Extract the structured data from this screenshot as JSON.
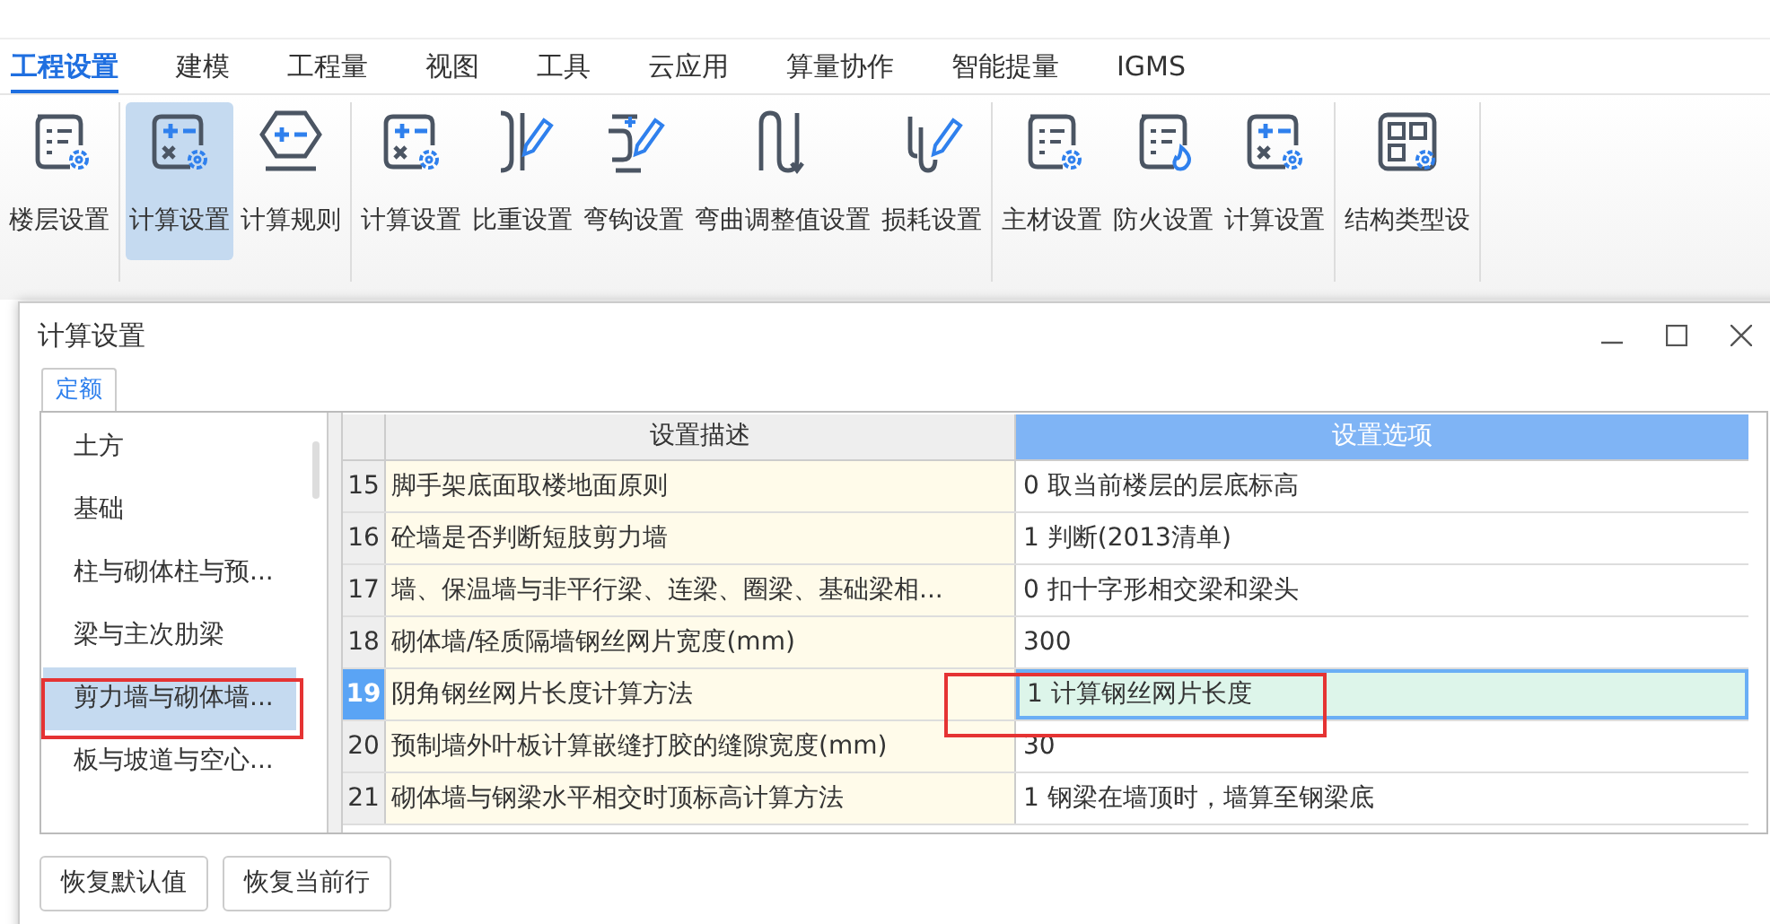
{
  "menu_tabs": [
    {
      "label": "工程设置",
      "selected": true
    },
    {
      "label": "建模",
      "selected": false
    },
    {
      "label": "工程量",
      "selected": false
    },
    {
      "label": "视图",
      "selected": false
    },
    {
      "label": "工具",
      "selected": false
    },
    {
      "label": "云应用",
      "selected": false
    },
    {
      "label": "算量协作",
      "selected": false
    },
    {
      "label": "智能提量",
      "selected": false
    },
    {
      "label": "IGMS",
      "selected": false
    }
  ],
  "ribbon_groups": [
    {
      "buttons": [
        {
          "label": "楼层设置",
          "kind": "doc",
          "selected": false
        }
      ]
    },
    {
      "buttons": [
        {
          "label": "计算设置",
          "kind": "calc",
          "selected": true
        },
        {
          "label": "计算规则",
          "kind": "rule",
          "selected": false
        }
      ]
    },
    {
      "buttons": [
        {
          "label": "计算设置",
          "kind": "calc",
          "selected": false
        },
        {
          "label": "比重设置",
          "kind": "hookpen",
          "selected": false
        },
        {
          "label": "弯钩设置",
          "kind": "bendpen",
          "selected": false
        },
        {
          "label": "弯曲调整值设置",
          "kind": "wave",
          "selected": false
        },
        {
          "label": "损耗设置",
          "kind": "wirepen",
          "selected": false
        }
      ]
    },
    {
      "buttons": [
        {
          "label": "主材设置",
          "kind": "doc",
          "selected": false
        },
        {
          "label": "防火设置",
          "kind": "fire",
          "selected": false
        },
        {
          "label": "计算设置",
          "kind": "calc",
          "selected": false
        }
      ]
    },
    {
      "buttons": [
        {
          "label": "结构类型设",
          "kind": "grid",
          "selected": false
        }
      ]
    }
  ],
  "dialog": {
    "title": "计算设置",
    "tabs": [
      {
        "label": "定额",
        "selected": true
      }
    ],
    "categories": [
      {
        "label": "土方",
        "selected": false
      },
      {
        "label": "基础",
        "selected": false
      },
      {
        "label": "柱与砌体柱与预...",
        "selected": false
      },
      {
        "label": "梁与主次肋梁",
        "selected": false
      },
      {
        "label": "剪力墙与砌体墙...",
        "selected": true
      },
      {
        "label": "板与坡道与空心...",
        "selected": false
      }
    ],
    "table": {
      "columns": [
        "设置描述",
        "设置选项"
      ],
      "rows": [
        {
          "number": "15",
          "description": "脚手架底面取楼地面原则",
          "option": "0 取当前楼层的层底标高",
          "selected": false
        },
        {
          "number": "16",
          "description": "砼墙是否判断短肢剪力墙",
          "option": "1 判断(2013清单)",
          "selected": false
        },
        {
          "number": "17",
          "description": "墙、保温墙与非平行梁、连梁、圈梁、基础梁相...",
          "option": "0 扣十字形相交梁和梁头",
          "selected": false
        },
        {
          "number": "18",
          "description": "砌体墙/轻质隔墙钢丝网片宽度(mm)",
          "option": "300",
          "selected": false
        },
        {
          "number": "19",
          "description": "阴角钢丝网片长度计算方法",
          "option": "1 计算钢丝网片长度",
          "selected": true
        },
        {
          "number": "20",
          "description": "预制墙外叶板计算嵌缝打胶的缝隙宽度(mm)",
          "option": "30",
          "selected": false
        },
        {
          "number": "21",
          "description": "砌体墙与钢梁水平相交时顶标高计算方法",
          "option": "1 钢梁在墙顶时，墙算至钢梁底",
          "selected": false
        }
      ]
    },
    "buttons": [
      "恢复默认值",
      "恢复当前行"
    ]
  }
}
